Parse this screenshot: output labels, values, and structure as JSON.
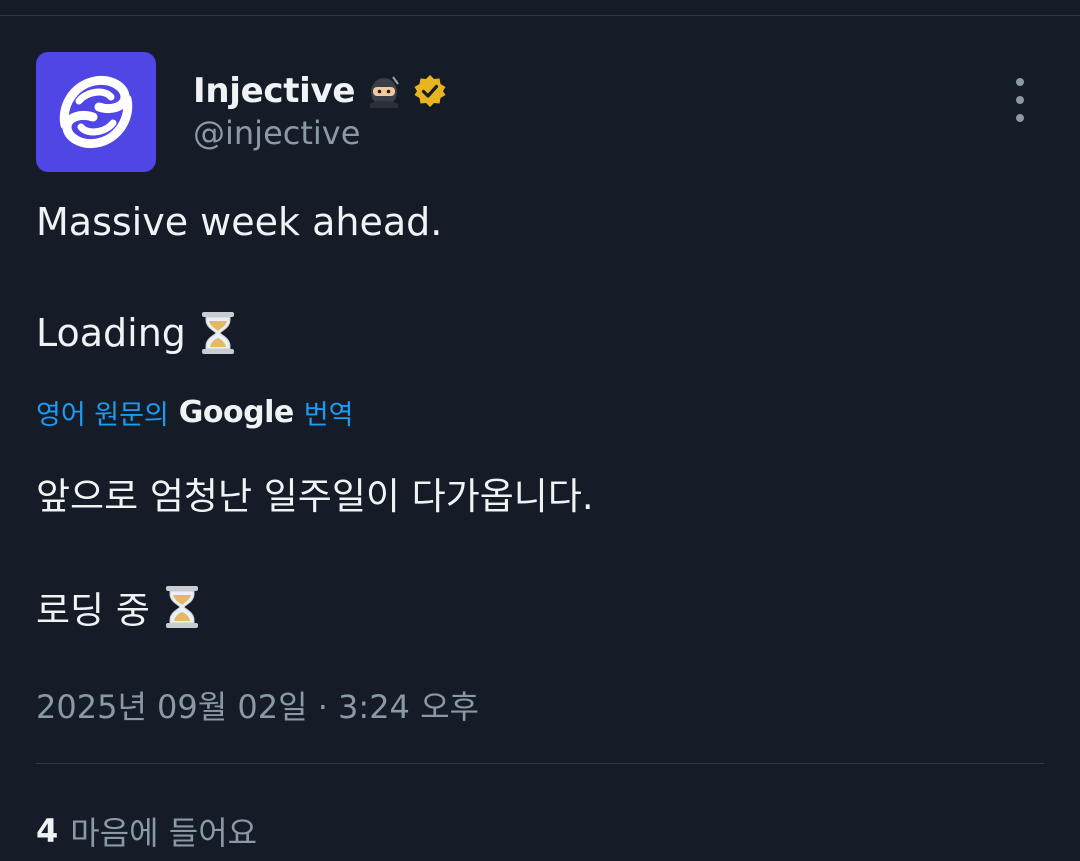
{
  "author": {
    "display_name": "Injective",
    "handle": "@injective",
    "badge_icon": "ninja-emoji-icon",
    "verified_icon": "verified-badge-icon",
    "verified_color": "#e8b421",
    "avatar_color": "#4f46e5"
  },
  "tweet": {
    "line1": "Massive week ahead.",
    "line2": "Loading",
    "translation_source": "영어 원문의",
    "translation_provider": "Google",
    "translation_action": "번역",
    "translated_line1": "앞으로 엄청난 일주일이 다가옵니다.",
    "translated_line2": "로딩 중",
    "timestamp": "2025년 09월 02일 · 3:24 오후"
  },
  "stats": {
    "likes_count": "4",
    "likes_label": "마음에 들어요"
  },
  "colors": {
    "background": "#151c28",
    "link": "#1d9bf0",
    "muted": "#8b98a5"
  }
}
